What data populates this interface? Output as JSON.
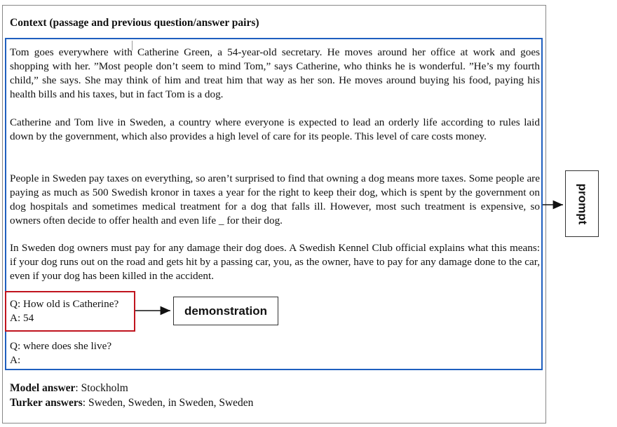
{
  "context_title": "Context (passage and previous question/answer pairs)",
  "passage": [
    "Tom goes everywhere with Catherine Green, a 54-year-old secretary. He moves around her office at work and goes shopping with her. ”Most people don’t seem to mind Tom,” says Catherine, who thinks he is wonderful. ”He’s my fourth child,” she says. She may think of him and treat him that way as her son. He moves around buying his food, paying his health bills and his taxes, but in fact Tom is a dog.",
    "Catherine and Tom live in Sweden, a country where everyone is expected to lead an orderly life according to rules laid down by the government, which also provides a high level of care for its people. This level of care costs money.",
    "People in Sweden pay taxes on everything, so aren’t surprised to find that owning a dog means more taxes. Some people are paying as much as 500 Swedish kronor in taxes a year for the right to keep their dog, which is spent by the government on dog hospitals and sometimes medical treatment for a dog that falls ill. However, most such treatment is expensive, so owners often decide to offer health and even life _ for their dog.",
    "In Sweden dog owners must pay for any damage their dog does.  A Swedish Kennel Club official explains what this means: if your dog runs out on the road and gets hit by a passing car, you, as the owner, have to pay for any damage done to the car, even if your dog has been killed in the accident."
  ],
  "demonstration": {
    "q": "Q: How old is Catherine?",
    "a": "A: 54"
  },
  "query": {
    "q": "Q: where does she live?",
    "a": "A:"
  },
  "labels": {
    "demonstration": "demonstration",
    "prompt": "prompt"
  },
  "model_answer": {
    "label": "Model answer",
    "value": ": Stockholm"
  },
  "turker_answers": {
    "label": "Turker answers",
    "value": ": Sweden, Sweden, in Sweden, Sweden"
  },
  "colors": {
    "prompt_box": "#1f5fbf",
    "demo_box": "#c0141e"
  }
}
